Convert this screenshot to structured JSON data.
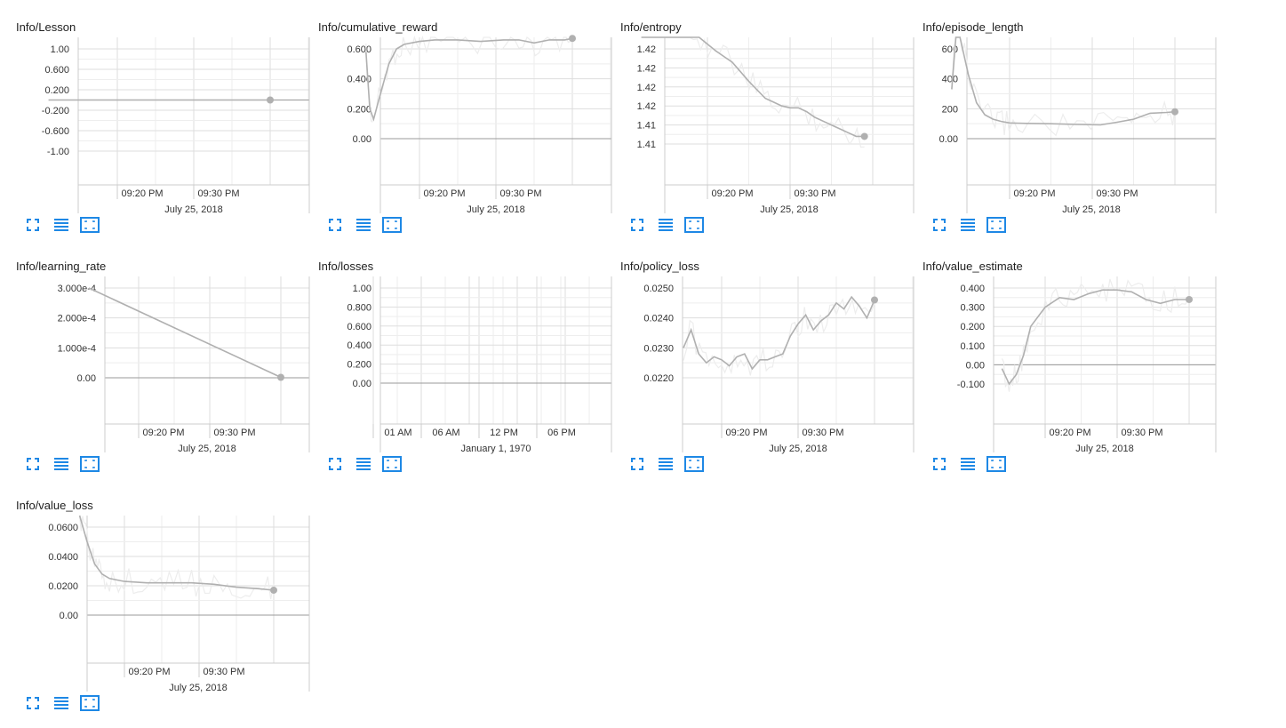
{
  "accent_color": "#1e88e5",
  "line_color": "#b0b0b0",
  "raw_line_color": "#ededed",
  "toolbar": {
    "icons": [
      "fit-to-screen-icon",
      "data-table-icon",
      "reset-axes-icon"
    ]
  },
  "chart_data": [
    {
      "title": "Info/Lesson",
      "type": "line",
      "x_ticks": [
        "09:20 PM",
        "09:30 PM"
      ],
      "x_sublabel": "July 25, 2018",
      "y_ticks": [
        "1.00",
        "0.600",
        "0.200",
        "-0.200",
        "-0.600",
        "-1.00"
      ],
      "ylim": [
        -1.2,
        1.2
      ],
      "x": [
        "21:11",
        "21:40"
      ],
      "series": [
        {
          "smoothed": [
            0,
            0
          ]
        }
      ]
    },
    {
      "title": "Info/cumulative_reward",
      "type": "line",
      "x_ticks": [
        "09:20 PM",
        "09:30 PM"
      ],
      "x_sublabel": "July 25, 2018",
      "y_ticks": [
        "0.600",
        "0.400",
        "0.200",
        "0.00"
      ],
      "ylim": [
        -0.3,
        0.8
      ],
      "x": [
        "21:13",
        "21:13.5",
        "21:14",
        "21:15",
        "21:16",
        "21:17",
        "21:18",
        "21:20",
        "21:22",
        "21:25",
        "21:28",
        "21:31",
        "21:33",
        "21:35",
        "21:37",
        "21:39",
        "21:40"
      ],
      "series": [
        {
          "smoothed": [
            0.58,
            0.2,
            0.13,
            0.32,
            0.5,
            0.6,
            0.63,
            0.65,
            0.66,
            0.66,
            0.65,
            0.66,
            0.66,
            0.64,
            0.66,
            0.66,
            0.67
          ]
        }
      ]
    },
    {
      "title": "Info/entropy",
      "type": "line",
      "x_ticks": [
        "09:20 PM",
        "09:30 PM"
      ],
      "x_sublabel": "July 25, 2018",
      "y_ticks": [
        "1.42",
        "1.42",
        "1.42",
        "1.42",
        "1.41",
        "1.41"
      ],
      "ylim": [
        1.41,
        1.425
      ],
      "x": [
        "21:12",
        "21:13",
        "21:14",
        "21:15",
        "21:16",
        "21:17",
        "21:18",
        "21:19",
        "21:20",
        "21:21",
        "21:22",
        "21:23",
        "21:24",
        "21:25",
        "21:26",
        "21:27",
        "21:28",
        "21:29",
        "21:30",
        "21:31",
        "21:32",
        "21:33",
        "21:34",
        "21:35",
        "21:36",
        "21:37",
        "21:38",
        "21:39"
      ],
      "series": [
        {
          "smoothed": [
            1.4224,
            1.4232,
            1.4238,
            1.424,
            1.4234,
            1.4226,
            1.4218,
            1.4214,
            1.4205,
            1.4198,
            1.4192,
            1.4186,
            1.4176,
            1.4166,
            1.4157,
            1.4148,
            1.4144,
            1.414,
            1.4138,
            1.4138,
            1.4134,
            1.4128,
            1.4124,
            1.412,
            1.4116,
            1.4112,
            1.4108,
            1.4108
          ]
        }
      ]
    },
    {
      "title": "Info/episode_length",
      "type": "line",
      "x_ticks": [
        "09:20 PM",
        "09:30 PM"
      ],
      "x_sublabel": "July 25, 2018",
      "y_ticks": [
        "600",
        "400",
        "200",
        "0.00"
      ],
      "ylim": [
        -150,
        800
      ],
      "x": [
        "21:13",
        "21:13.5",
        "21:14",
        "21:15",
        "21:16",
        "21:17",
        "21:18",
        "21:19",
        "21:20",
        "21:22",
        "21:25",
        "21:28",
        "21:31",
        "21:33",
        "21:35",
        "21:37",
        "21:39",
        "21:40"
      ],
      "series": [
        {
          "smoothed": [
            330,
            780,
            720,
            430,
            240,
            160,
            130,
            115,
            105,
            102,
            100,
            95,
            92,
            110,
            130,
            170,
            175,
            180
          ]
        }
      ]
    },
    {
      "title": "Info/learning_rate",
      "type": "line",
      "x_ticks": [
        "09:20 PM",
        "09:30 PM"
      ],
      "x_sublabel": "July 25, 2018",
      "y_ticks": [
        "3.000e-4",
        "2.000e-4",
        "1.000e-4",
        "0.00"
      ],
      "ylim": [
        -4e-07,
        0.00032
      ],
      "x": [
        "21:13",
        "21:40"
      ],
      "series": [
        {
          "smoothed": [
            0.0003,
            1.5e-06
          ]
        }
      ]
    },
    {
      "title": "Info/losses",
      "type": "line",
      "x_ticks": [
        "01 AM",
        "06 AM",
        "12 PM",
        "06 PM"
      ],
      "x_sublabel": "January 1, 1970",
      "y_ticks": [
        "1.00",
        "0.800",
        "0.600",
        "0.400",
        "0.200",
        "0.00"
      ],
      "ylim": [
        -0.1,
        1.1
      ],
      "x": [],
      "series": []
    },
    {
      "title": "Info/policy_loss",
      "type": "line",
      "x_ticks": [
        "09:20 PM",
        "09:30 PM"
      ],
      "x_sublabel": "July 25, 2018",
      "y_ticks": [
        "0.0250",
        "0.0240",
        "0.0230",
        "0.0220"
      ],
      "ylim": [
        0.0215,
        0.0252
      ],
      "x": [
        "21:15",
        "21:16",
        "21:17",
        "21:18",
        "21:19",
        "21:20",
        "21:21",
        "21:22",
        "21:23",
        "21:24",
        "21:25",
        "21:26",
        "21:27",
        "21:28",
        "21:29",
        "21:30",
        "21:31",
        "21:32",
        "21:33",
        "21:34",
        "21:35",
        "21:36",
        "21:37",
        "21:38",
        "21:39",
        "21:40"
      ],
      "series": [
        {
          "smoothed": [
            0.023,
            0.0236,
            0.0228,
            0.0225,
            0.0227,
            0.0226,
            0.0224,
            0.0227,
            0.0228,
            0.0223,
            0.0226,
            0.0226,
            0.0227,
            0.0228,
            0.0234,
            0.0238,
            0.0241,
            0.0236,
            0.0239,
            0.0241,
            0.0245,
            0.0243,
            0.0247,
            0.0244,
            0.024,
            0.0246
          ]
        }
      ]
    },
    {
      "title": "Info/value_estimate",
      "type": "line",
      "x_ticks": [
        "09:20 PM",
        "09:30 PM"
      ],
      "x_sublabel": "July 25, 2018",
      "y_ticks": [
        "0.400",
        "0.300",
        "0.200",
        "0.100",
        "0.00",
        "-0.100"
      ],
      "ylim": [
        -0.15,
        0.45
      ],
      "x": [
        "21:14",
        "21:15",
        "21:16",
        "21:17",
        "21:18",
        "21:20",
        "21:22",
        "21:24",
        "21:26",
        "21:28",
        "21:30",
        "21:32",
        "21:34",
        "21:36",
        "21:38",
        "21:40"
      ],
      "series": [
        {
          "smoothed": [
            -0.02,
            -0.1,
            -0.05,
            0.05,
            0.2,
            0.3,
            0.35,
            0.34,
            0.37,
            0.39,
            0.39,
            0.38,
            0.34,
            0.32,
            0.34,
            0.34
          ]
        }
      ]
    },
    {
      "title": "Info/value_loss",
      "type": "line",
      "x_ticks": [
        "09:20 PM",
        "09:30 PM"
      ],
      "x_sublabel": "July 25, 2018",
      "y_ticks": [
        "0.0600",
        "0.0400",
        "0.0200",
        "0.00"
      ],
      "ylim": [
        -0.012,
        0.07
      ],
      "x": [
        "21:14",
        "21:15",
        "21:16",
        "21:17",
        "21:18",
        "21:20",
        "21:23",
        "21:26",
        "21:29",
        "21:32",
        "21:35",
        "21:38",
        "21:40"
      ],
      "series": [
        {
          "smoothed": [
            0.07,
            0.05,
            0.035,
            0.028,
            0.025,
            0.023,
            0.022,
            0.022,
            0.022,
            0.021,
            0.019,
            0.018,
            0.017
          ]
        }
      ]
    }
  ]
}
